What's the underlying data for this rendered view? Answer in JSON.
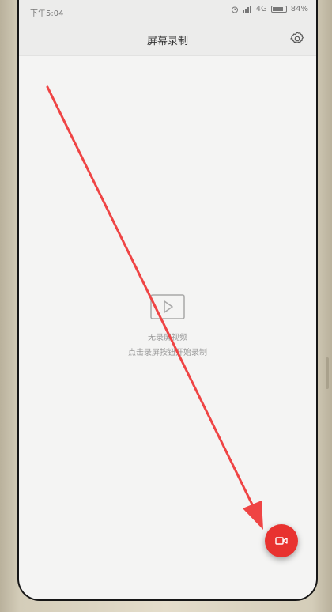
{
  "status_bar": {
    "time": "下午5:04",
    "network": "4G",
    "battery": "84%",
    "battery_level": 0.84
  },
  "header": {
    "title": "屏幕录制",
    "settings_icon": "gear-icon"
  },
  "empty_state": {
    "icon": "video-play-icon",
    "title": "无录屏视频",
    "hint": "点击录屏按钮开始录制"
  },
  "record_button": {
    "icon": "video-camera-icon",
    "color": "#e8322f"
  },
  "annotation": {
    "arrow_color": "#ef4444"
  }
}
